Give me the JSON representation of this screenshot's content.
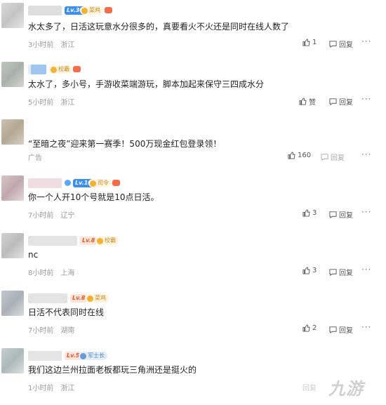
{
  "comments": [
    {
      "level": "Lv.30",
      "badge": "菜鸡",
      "text": "水太多了，日活这玩意水分很多的，真要看火不火还是同时在线人数了",
      "time": "3小时前",
      "location": "浙江",
      "likes": "1",
      "reply": "回复",
      "more": "···"
    },
    {
      "badge": "校霸",
      "text": "太水了，多小号，手游收菜端游玩，脚本加起来保守三四成水分",
      "time": "5小时前",
      "location": "浙江",
      "likes": "赞",
      "reply": "回复",
      "more": "···"
    },
    {
      "text": "“至暗之夜”迎来第一赛季！500万现金红包登录领！",
      "tag": "广告",
      "likes": "160",
      "reply": "回复",
      "more": "···"
    },
    {
      "level": "Lv.10",
      "badge": "司令",
      "text": "你一个人开10个号就是10点日活。",
      "time": "7小时前",
      "location": "辽宁",
      "likes": "3",
      "reply": "回复",
      "more": "···"
    },
    {
      "level": "Lv.8",
      "badge": "校霸",
      "text": "nc",
      "time": "8小时前",
      "location": "上海",
      "likes": "3",
      "reply": "回复",
      "more": "···"
    },
    {
      "level": "Lv.8",
      "badge": "菜鸡",
      "text": "日活不代表同时在线",
      "time": "7小时前",
      "location": "湖南",
      "likes": "2",
      "reply": "回复",
      "more": "···"
    },
    {
      "level": "Lv.5",
      "badge": "军士长",
      "text": "我们这边兰州拉面老板都玩三角洲还是挺火的",
      "time": "1小时前",
      "location": "浙江",
      "reply": "回复",
      "more": "···"
    }
  ],
  "watermark": "九游"
}
